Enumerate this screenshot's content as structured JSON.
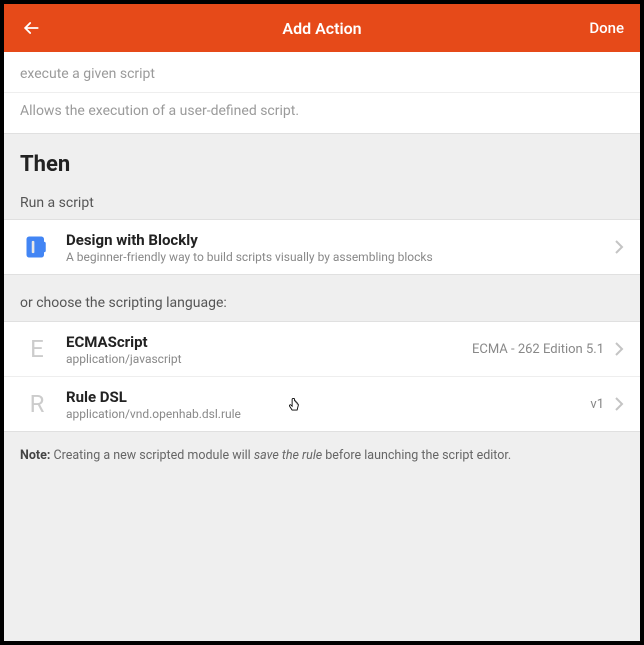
{
  "header": {
    "title": "Add Action",
    "done": "Done"
  },
  "intro": {
    "line1": "execute a given script",
    "line2": "Allows the execution of a user-defined script."
  },
  "then_heading": "Then",
  "run_section_label": "Run a script",
  "blockly": {
    "title": "Design with Blockly",
    "sub": "A beginner-friendly way to build scripts visually by assembling blocks"
  },
  "or_label": "or choose the scripting language:",
  "langs": [
    {
      "letter": "E",
      "title": "ECMAScript",
      "sub": "application/javascript",
      "meta": "ECMA - 262 Edition 5.1"
    },
    {
      "letter": "R",
      "title": "Rule DSL",
      "sub": "application/vnd.openhab.dsl.rule",
      "meta": "v1"
    }
  ],
  "note": {
    "prefix": "Note:",
    "before": " Creating a new scripted module will ",
    "italic": "save the rule",
    "after": " before launching the script editor."
  }
}
